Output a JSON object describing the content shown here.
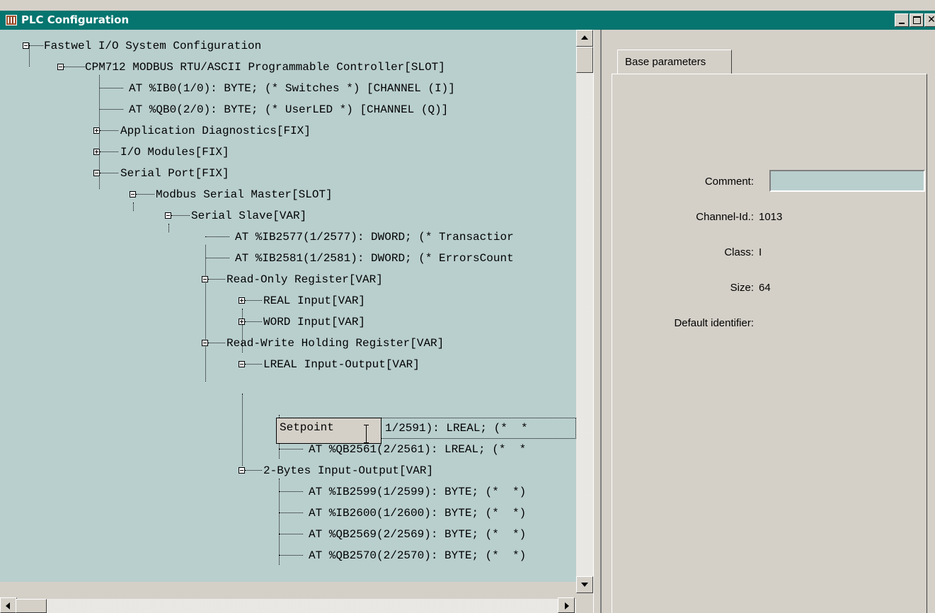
{
  "window": {
    "title": "PLC Configuration"
  },
  "tree": {
    "rows": [
      {
        "text": "Fastwel I/O System Configuration"
      },
      {
        "text": "CPM712 MODBUS RTU/ASCII Programmable Controller[SLOT]"
      },
      {
        "text": "AT %IB0(1/0): BYTE; (* Switches *) [CHANNEL (I)]"
      },
      {
        "text": "AT %QB0(2/0): BYTE; (* UserLED *) [CHANNEL (Q)]"
      },
      {
        "text": "Application Diagnostics[FIX]"
      },
      {
        "text": "I/O Modules[FIX]"
      },
      {
        "text": "Serial Port[FIX]"
      },
      {
        "text": "Modbus Serial Master[SLOT]"
      },
      {
        "text": "Serial Slave[VAR]"
      },
      {
        "text": "AT %IB2577(1/2577): DWORD; (* Transactior"
      },
      {
        "text": "AT %IB2581(1/2581): DWORD; (* ErrorsCount"
      },
      {
        "text": "Read-Only Register[VAR]"
      },
      {
        "text": "REAL Input[VAR]"
      },
      {
        "text": "WORD Input[VAR]"
      },
      {
        "text": "Read-Write Holding Register[VAR]"
      },
      {
        "text": "LREAL Input-Output[VAR]"
      },
      {
        "text": "1/2591): LREAL; (*  *"
      },
      {
        "text": "AT %QB2561(2/2561): LREAL; (*  *"
      },
      {
        "text": "2-Bytes Input-Output[VAR]"
      },
      {
        "text": "AT %IB2599(1/2599): BYTE; (*  *)"
      },
      {
        "text": "AT %IB2600(1/2600): BYTE; (*  *)"
      },
      {
        "text": "AT %QB2569(2/2569): BYTE; (*  *)"
      },
      {
        "text": "AT %QB2570(2/2570): BYTE; (*  *)"
      }
    ],
    "edit_value": "Setpoint"
  },
  "properties": {
    "tab_label": "Base parameters",
    "comment_label": "Comment:",
    "comment_value": "",
    "channel_id_label": "Channel-Id.:",
    "channel_id_value": "1013",
    "class_label": "Class:",
    "class_value": "I",
    "size_label": "Size:",
    "size_value": "64",
    "default_identifier_label": "Default identifier:"
  }
}
